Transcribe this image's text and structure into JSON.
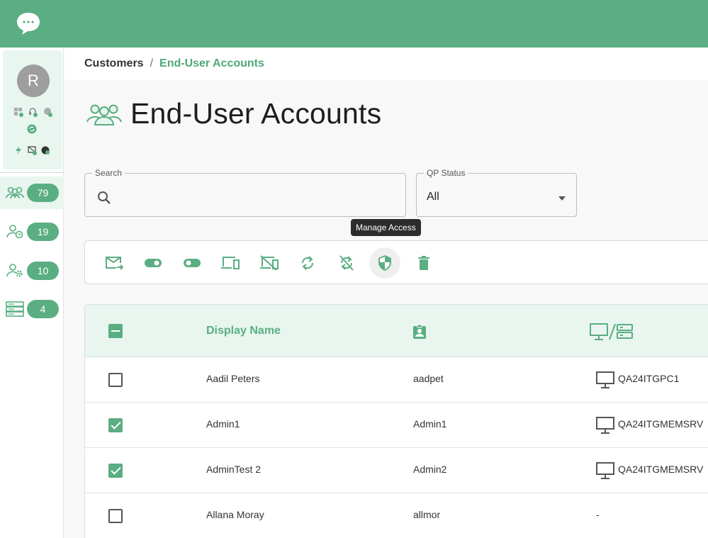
{
  "brand": {
    "accent": "#5aae82",
    "accent_light": "#e8f6ef"
  },
  "sidebar": {
    "avatar_initial": "R",
    "nav": [
      {
        "icon": "users-group-icon",
        "count": "79",
        "active": true
      },
      {
        "icon": "user-clock-icon",
        "count": "19",
        "active": false
      },
      {
        "icon": "user-gear-icon",
        "count": "10",
        "active": false
      },
      {
        "icon": "server-icon",
        "count": "4",
        "active": false
      }
    ]
  },
  "breadcrumb": {
    "root": "Customers",
    "separator": "/",
    "current": "End-User Accounts"
  },
  "page": {
    "title": "End-User Accounts"
  },
  "filters": {
    "search": {
      "label": "Search",
      "value": "",
      "placeholder": ""
    },
    "qp_status": {
      "label": "QP Status",
      "value": "All"
    }
  },
  "tooltip": {
    "text": "Manage Access"
  },
  "toolbar": {
    "actions": [
      "send-email-icon",
      "toggle-on-icon",
      "toggle-off-icon",
      "devices-icon",
      "devices-off-icon",
      "sync-icon",
      "sync-off-icon",
      "manage-access-shield-icon",
      "delete-icon"
    ]
  },
  "table": {
    "columns": {
      "name": "Display Name",
      "username": "badge-icon",
      "machine": "monitor-server-icon"
    },
    "rows": [
      {
        "checked": false,
        "name": "Aadil Peters",
        "username": "aadpet",
        "machine": "QA24ITGPC1",
        "has_icon": true
      },
      {
        "checked": true,
        "name": "Admin1",
        "username": "Admin1",
        "machine": "QA24ITGMEMSRV",
        "has_icon": true
      },
      {
        "checked": true,
        "name": "AdminTest 2",
        "username": "Admin2",
        "machine": "QA24ITGMEMSRV",
        "has_icon": true
      },
      {
        "checked": false,
        "name": "Allana Moray",
        "username": "allmor",
        "machine": "-",
        "has_icon": false
      }
    ]
  }
}
